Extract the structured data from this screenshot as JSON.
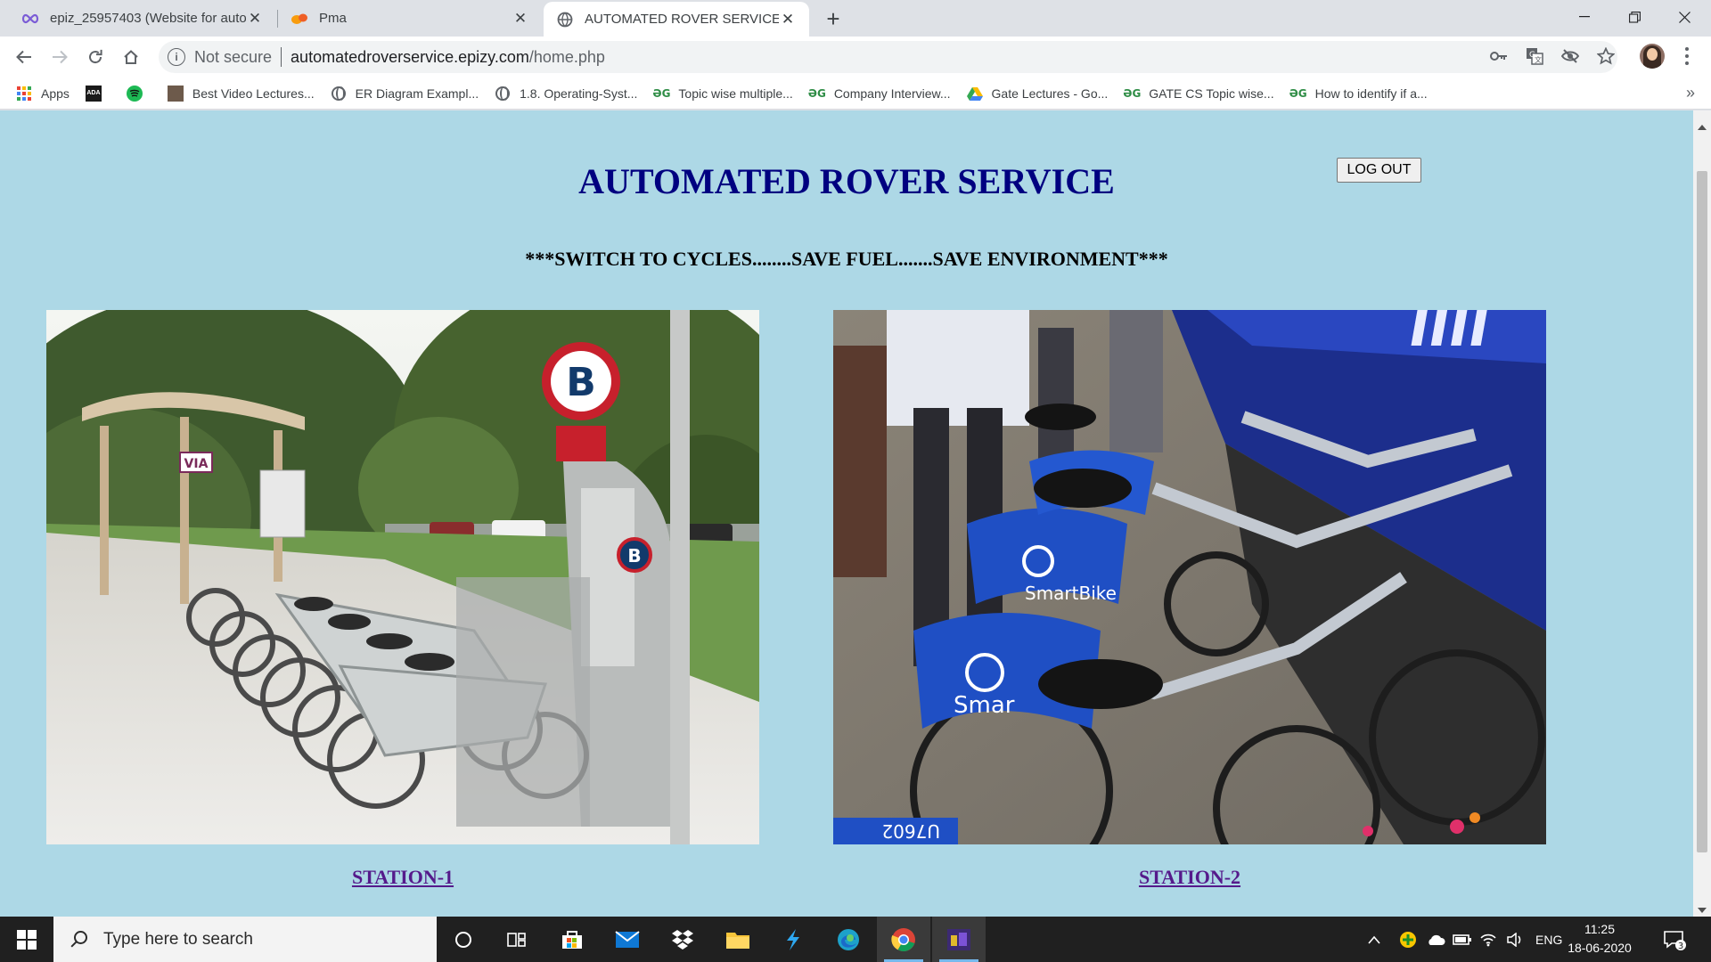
{
  "browser": {
    "tabs": [
      {
        "title": "epiz_25957403 (Website for auto",
        "active": false
      },
      {
        "title": "Pma",
        "active": false
      },
      {
        "title": "AUTOMATED ROVER SERVICE",
        "active": true
      }
    ],
    "omnibox": {
      "security_label": "Not secure",
      "url_host": "automatedroverservice.epizy.com",
      "url_path": "/home.php"
    },
    "bookmarks": [
      {
        "label": "Apps",
        "icon": "apps-grid-icon"
      },
      {
        "label": "",
        "icon": "ada-icon"
      },
      {
        "label": "",
        "icon": "spotify-icon"
      },
      {
        "label": "Best Video Lectures...",
        "icon": "thumbnail-icon"
      },
      {
        "label": "ER Diagram Exampl...",
        "icon": "globe-icon"
      },
      {
        "label": "1.8. Operating-Syst...",
        "icon": "globe-icon"
      },
      {
        "label": "Topic wise multiple...",
        "icon": "geeksforgeeks-icon"
      },
      {
        "label": "Company Interview...",
        "icon": "geeksforgeeks-icon"
      },
      {
        "label": "Gate Lectures - Go...",
        "icon": "google-drive-icon"
      },
      {
        "label": "GATE CS Topic wise...",
        "icon": "geeksforgeeks-icon"
      },
      {
        "label": "How to identify if a...",
        "icon": "geeksforgeeks-icon"
      }
    ]
  },
  "page": {
    "heading": "AUTOMATED ROVER SERVICE",
    "logout_label": "LOG OUT",
    "slogan": "***SWITCH TO CYCLES........SAVE FUEL.......SAVE ENVIRONMENT***",
    "stations": [
      {
        "label": "STATION-1",
        "photo": "bike-share-dock-photo"
      },
      {
        "label": "STATION-2",
        "photo": "smartbike-rack-photo"
      }
    ],
    "photo_text": {
      "station1_sign": "B",
      "station1_shelter": "VIA",
      "station2_brand": "SmartBike",
      "station2_brand_partial": "Smar",
      "station2_plate": "U7602"
    }
  },
  "taskbar": {
    "search_placeholder": "Type here to search",
    "language": "ENG",
    "time": "11:25",
    "date": "18-06-2020",
    "notification_count": "3"
  },
  "colors": {
    "page_background": "#add8e6",
    "heading": "#000080",
    "visited_link": "#551a8b"
  }
}
